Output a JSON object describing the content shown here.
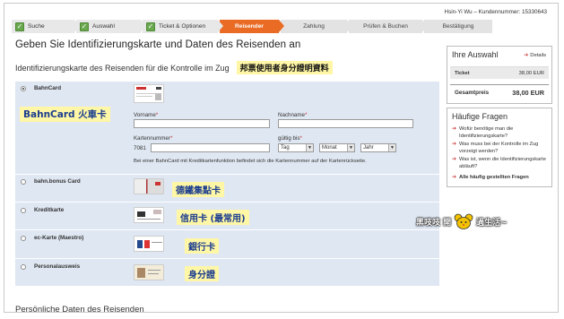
{
  "header": {
    "user_line": "Hsin-Yi Wu – Kundennummer: 15330643",
    "steps": [
      {
        "label": "Suche",
        "done": true
      },
      {
        "label": "Auswahl",
        "done": true
      },
      {
        "label": "Ticket & Optionen",
        "done": true
      },
      {
        "label": "Reisender",
        "active": true
      },
      {
        "label": "Zahlung"
      },
      {
        "label": "Prüfen & Buchen"
      },
      {
        "label": "Bestätigung"
      }
    ]
  },
  "main": {
    "title": "Geben Sie Identifizierungskarte und Daten des Reisenden an",
    "subtitle": "Identifizierungskarte des Reisenden für die Kontrolle im Zug",
    "subtitle_note": "邦票使用者身分證明資料",
    "options": [
      {
        "label": "BahnCard",
        "note": "BahnCard 火車卡",
        "selected": true
      },
      {
        "label": "bahn.bonus Card",
        "note": "德鐵集點卡",
        "selected": false
      },
      {
        "label": "Kreditkarte",
        "note": "信用卡 (最常用)",
        "selected": false
      },
      {
        "label": "ec-Karte (Maestro)",
        "note": "銀行卡",
        "selected": false
      },
      {
        "label": "Personalausweis",
        "note": "身分證",
        "selected": false
      }
    ],
    "bahncard_form": {
      "vorname_label": "Vorname",
      "nachname_label": "Nachname",
      "kartennummer_label": "Kartennummer",
      "kartennummer_prefix": "7081",
      "gueltig_label": "gültig bis",
      "required_mark": "*",
      "tag": "Tag",
      "monat": "Monat",
      "jahr": "Jahr",
      "hint": "Bei einer BahnCard mit Kreditkartenfunktion befindet sich die Kartennummer auf der Kartenrückseite."
    },
    "section2_title": "Persönliche Daten des Reisenden"
  },
  "sidebar": {
    "auswahl_title": "Ihre Auswahl",
    "details_label": "Details",
    "ticket_label": "Ticket",
    "ticket_price": "38,00 EUR",
    "gesamt_label": "Gesamtpreis",
    "gesamt_price": "38,00 EUR",
    "faq_title": "Häufige Fragen",
    "faq_items": [
      "Wofür benötige man die Identifizierungskarte?",
      "Was muss bei der Kontrolle im Zug vorzeigt werden?",
      "Was ist, wenn die Identifizierungskarte abläuft?"
    ],
    "faq_all": "Alle häufig gestellten Fragen"
  },
  "watermark": {
    "text_left": "黑吱吱 開",
    "text_right": "過生活~"
  },
  "colors": {
    "accent": "#e96b24",
    "done_check": "#6aa84f",
    "option_bg": "#dfe7f2",
    "highlight": "#fff6a6",
    "note_blue": "#1a3d8f"
  }
}
